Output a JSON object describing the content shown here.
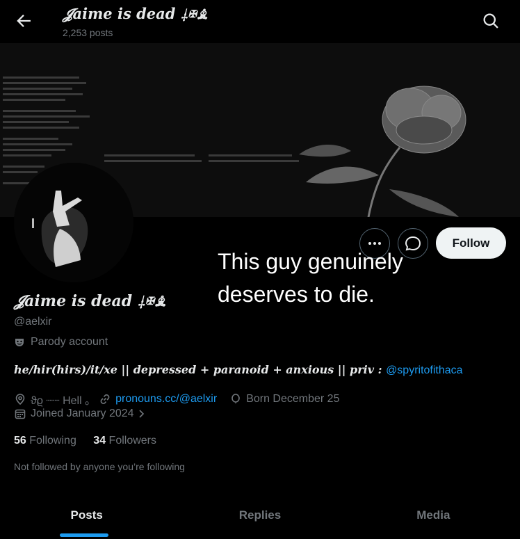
{
  "header": {
    "title": "𝓙aime is dead ⸸✠♗",
    "posts_count": "2,253 posts"
  },
  "profile": {
    "name": "𝓙aime is dead ⸸✠♗",
    "handle": "@aelxir",
    "parody_label": "Parody account",
    "bio_text": "he/hir(hirs)/it/xe || depressed + paranoid + anxious || priv : ",
    "bio_mention": "@spyritofithaca",
    "location": "ϑϱ ┈┈ Hell ｡",
    "website": "pronouns.cc/@aelxir",
    "birthday": "Born December 25",
    "joined": "Joined January 2024",
    "following_count": "56",
    "following_label": "Following",
    "followers_count": "34",
    "followers_label": "Followers",
    "not_followed": "Not followed by anyone you’re following"
  },
  "actions": {
    "follow_label": "Follow"
  },
  "overlay_caption": "This guy genuinely deserves to die.",
  "tabs": [
    {
      "label": "Posts"
    },
    {
      "label": "Replies"
    },
    {
      "label": "Media"
    }
  ],
  "colors": {
    "accent": "#1d9bf0",
    "muted": "#71767b",
    "text": "#e7e9ea",
    "background": "#000000"
  }
}
